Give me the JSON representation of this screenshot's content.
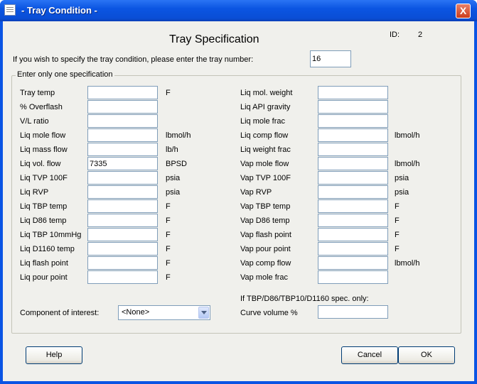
{
  "window": {
    "title": "- Tray Condition -",
    "close_glyph": "X"
  },
  "header": {
    "heading": "Tray Specification",
    "id_label": "ID:",
    "id_value": "2"
  },
  "instruction": "If  you wish to specify the tray condition, please enter the tray number:",
  "tray_number": "16",
  "group_label": "Enter only one specification",
  "left_fields": [
    {
      "label": "Tray temp",
      "value": "",
      "unit": "F"
    },
    {
      "label": "% Overflash",
      "value": "",
      "unit": ""
    },
    {
      "label": "V/L ratio",
      "value": "",
      "unit": ""
    },
    {
      "label": "Liq mole flow",
      "value": "",
      "unit": "lbmol/h"
    },
    {
      "label": "Liq mass flow",
      "value": "",
      "unit": "lb/h"
    },
    {
      "label": "Liq vol. flow",
      "value": "7335",
      "unit": "BPSD"
    },
    {
      "label": "Liq TVP 100F",
      "value": "",
      "unit": "psia"
    },
    {
      "label": "Liq RVP",
      "value": "",
      "unit": "psia"
    },
    {
      "label": "Liq TBP temp",
      "value": "",
      "unit": "F"
    },
    {
      "label": "Liq D86 temp",
      "value": "",
      "unit": "F"
    },
    {
      "label": "Liq TBP 10mmHg",
      "value": "",
      "unit": "F"
    },
    {
      "label": "Liq D1160 temp",
      "value": "",
      "unit": "F"
    },
    {
      "label": "Liq flash point",
      "value": "",
      "unit": "F"
    },
    {
      "label": "Liq pour point",
      "value": "",
      "unit": "F"
    }
  ],
  "right_fields": [
    {
      "label": "Liq mol. weight",
      "value": "",
      "unit": ""
    },
    {
      "label": "Liq API gravity",
      "value": "",
      "unit": ""
    },
    {
      "label": "Liq mole frac",
      "value": "",
      "unit": ""
    },
    {
      "label": "Liq comp flow",
      "value": "",
      "unit": "lbmol/h"
    },
    {
      "label": "Liq weight frac",
      "value": "",
      "unit": ""
    },
    {
      "label": "Vap mole flow",
      "value": "",
      "unit": "lbmol/h"
    },
    {
      "label": "Vap TVP 100F",
      "value": "",
      "unit": "psia"
    },
    {
      "label": "Vap RVP",
      "value": "",
      "unit": "psia"
    },
    {
      "label": "Vap TBP temp",
      "value": "",
      "unit": "F"
    },
    {
      "label": "Vap D86 temp",
      "value": "",
      "unit": "F"
    },
    {
      "label": "Vap flash point",
      "value": "",
      "unit": "F"
    },
    {
      "label": "Vap pour point",
      "value": "",
      "unit": "F"
    },
    {
      "label": "Vap comp flow",
      "value": "",
      "unit": "lbmol/h"
    },
    {
      "label": "Vap mole frac",
      "value": "",
      "unit": ""
    }
  ],
  "component": {
    "label": "Component of interest:",
    "selected": "<None>"
  },
  "curve": {
    "note": "If TBP/D86/TBP10/D1160 spec. only:",
    "label": "Curve volume %",
    "value": ""
  },
  "buttons": {
    "help": "Help",
    "cancel": "Cancel",
    "ok": "OK"
  }
}
